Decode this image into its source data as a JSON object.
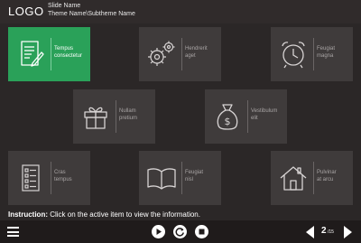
{
  "header": {
    "logo": "LOGO",
    "slide_name": "Slide Name",
    "theme": "Theme Name\\Subtheme Name"
  },
  "tiles": [
    {
      "label": "Tempus\nconsectetur",
      "icon": "document-pen-icon",
      "active": true
    },
    {
      "label": "Hendrerit\naget",
      "icon": "gears-icon",
      "active": false
    },
    {
      "label": "Feugiat\nmagna",
      "icon": "alarm-clock-icon",
      "active": false
    },
    {
      "label": "Nullam\npretium",
      "icon": "gift-icon",
      "active": false
    },
    {
      "label": "Vestibulum\nelit",
      "icon": "money-bag-icon",
      "active": false
    },
    {
      "label": "Cras\ntempus",
      "icon": "checklist-icon",
      "active": false
    },
    {
      "label": "Feugiat\nnisl",
      "icon": "open-book-icon",
      "active": false
    },
    {
      "label": "Pulvinar\nat arcu",
      "icon": "house-icon",
      "active": false
    }
  ],
  "instruction": {
    "prefix": "Instruction:",
    "text": " Click on the active item to view the information."
  },
  "footer": {
    "page_current": "2",
    "page_total": "/15"
  },
  "colors": {
    "background": "#2b2727",
    "tile": "#3f3b3b",
    "active_tile": "#2aa159",
    "footer": "#1f1b1b"
  }
}
